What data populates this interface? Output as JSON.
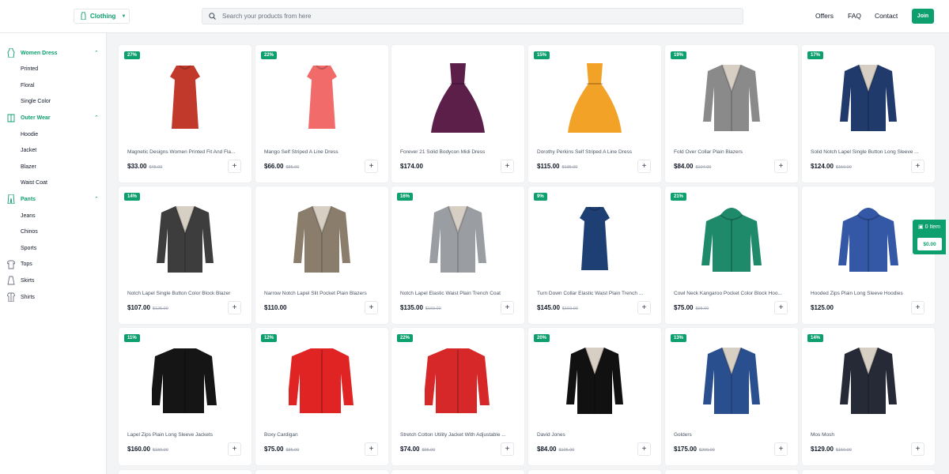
{
  "header": {
    "category_label": "Clothing",
    "search_placeholder": "Search your products from here",
    "nav": [
      "Offers",
      "FAQ",
      "Contact"
    ],
    "join_label": "Join"
  },
  "sidebar": {
    "items": [
      {
        "label": "Women Dress",
        "level": "parent",
        "open": true,
        "icon": "dress-icon"
      },
      {
        "label": "Printed",
        "level": "child"
      },
      {
        "label": "Floral",
        "level": "child"
      },
      {
        "label": "Single Color",
        "level": "child"
      },
      {
        "label": "Outer Wear",
        "level": "parent",
        "open": true,
        "icon": "jacket-icon"
      },
      {
        "label": "Hoodie",
        "level": "child"
      },
      {
        "label": "Jacket",
        "level": "child"
      },
      {
        "label": "Blazer",
        "level": "child"
      },
      {
        "label": "Waist Coat",
        "level": "child"
      },
      {
        "label": "Pants",
        "level": "parent",
        "open": true,
        "icon": "pants-icon"
      },
      {
        "label": "Jeans",
        "level": "child"
      },
      {
        "label": "Chinos",
        "level": "child"
      },
      {
        "label": "Sports",
        "level": "child"
      },
      {
        "label": "Tops",
        "level": "parent",
        "open": false,
        "icon": "tshirt-icon"
      },
      {
        "label": "Skirts",
        "level": "parent",
        "open": false,
        "icon": "skirt-icon"
      },
      {
        "label": "Shirts",
        "level": "parent",
        "open": false,
        "icon": "shirt-icon"
      }
    ]
  },
  "products": [
    {
      "badge": "27%",
      "name": "Magnetic Designs Women Printed Fit And Fla...",
      "price": "$33.00",
      "old_price": "$45.00",
      "kind": "dress",
      "color": "#c0392b"
    },
    {
      "badge": "22%",
      "name": "Mango Self Striped A Line Dress",
      "price": "$66.00",
      "old_price": "$85.00",
      "kind": "dress",
      "color": "#f26b6b"
    },
    {
      "badge": "",
      "name": "Forever 21 Solid Bodycon Midi Dress",
      "price": "$174.00",
      "old_price": "",
      "kind": "gown",
      "color": "#5b1f4a"
    },
    {
      "badge": "15%",
      "name": "Dorothy Perkins Self Striped A Line Dress",
      "price": "$115.00",
      "old_price": "$135.00",
      "kind": "gown",
      "color": "#f2a227"
    },
    {
      "badge": "19%",
      "name": "Fold Over Collar Plain Blazers",
      "price": "$84.00",
      "old_price": "$104.00",
      "kind": "blazer",
      "color": "#8a8a8a"
    },
    {
      "badge": "17%",
      "name": "Solid Notch Lapel Single Button Long Sleeve ...",
      "price": "$124.00",
      "old_price": "$150.00",
      "kind": "blazer",
      "color": "#1f3a6b"
    },
    {
      "badge": "14%",
      "name": "Notch Lapel Single Button Color Block Blazer",
      "price": "$107.00",
      "old_price": "$125.00",
      "kind": "blazer",
      "color": "#3d3d3d"
    },
    {
      "badge": "",
      "name": "Narrow Notch Lapel Slit Pocket Plain Blazers",
      "price": "$110.00",
      "old_price": "",
      "kind": "blazer",
      "color": "#8b7d6b"
    },
    {
      "badge": "16%",
      "name": "Notch Lapel Elastic Waist Plain Trench Coat",
      "price": "$135.00",
      "old_price": "$160.00",
      "kind": "blazer",
      "color": "#9a9ea3"
    },
    {
      "badge": "9%",
      "name": "Turn Down Collar Elastic Waist Plain Trench ...",
      "price": "$145.00",
      "old_price": "$160.00",
      "kind": "dress",
      "color": "#1e3f73"
    },
    {
      "badge": "21%",
      "name": "Cowl Neck Kangaroo Pocket Color Block Hoo...",
      "price": "$75.00",
      "old_price": "$95.00",
      "kind": "hoodie",
      "color": "#1f8a6a"
    },
    {
      "badge": "",
      "name": "Hooded Zips Plain Long Sleeve Hoodies",
      "price": "$125.00",
      "old_price": "",
      "kind": "hoodie",
      "color": "#3457a6"
    },
    {
      "badge": "11%",
      "name": "Lapel Zips Plain Long Sleeve Jackets",
      "price": "$160.00",
      "old_price": "$180.00",
      "kind": "jacket",
      "color": "#151515"
    },
    {
      "badge": "12%",
      "name": "Boxy Cardigan",
      "price": "$75.00",
      "old_price": "$85.00",
      "kind": "jacket",
      "color": "#e02424"
    },
    {
      "badge": "22%",
      "name": "Stretch Cotton Utility Jacket With Adjustable ...",
      "price": "$74.00",
      "old_price": "$95.00",
      "kind": "jacket",
      "color": "#d62828"
    },
    {
      "badge": "20%",
      "name": "David Jones",
      "price": "$84.00",
      "old_price": "$105.00",
      "kind": "blazer",
      "color": "#111111"
    },
    {
      "badge": "13%",
      "name": "Golders",
      "price": "$175.00",
      "old_price": "$200.00",
      "kind": "blazer",
      "color": "#2a4f8f"
    },
    {
      "badge": "14%",
      "name": "Mos Mosh",
      "price": "$129.00",
      "old_price": "$150.00",
      "kind": "blazer",
      "color": "#262a36"
    }
  ],
  "cart": {
    "items": "0 Item",
    "total": "$0.00"
  },
  "colors": {
    "accent": "#0d9f6e"
  }
}
